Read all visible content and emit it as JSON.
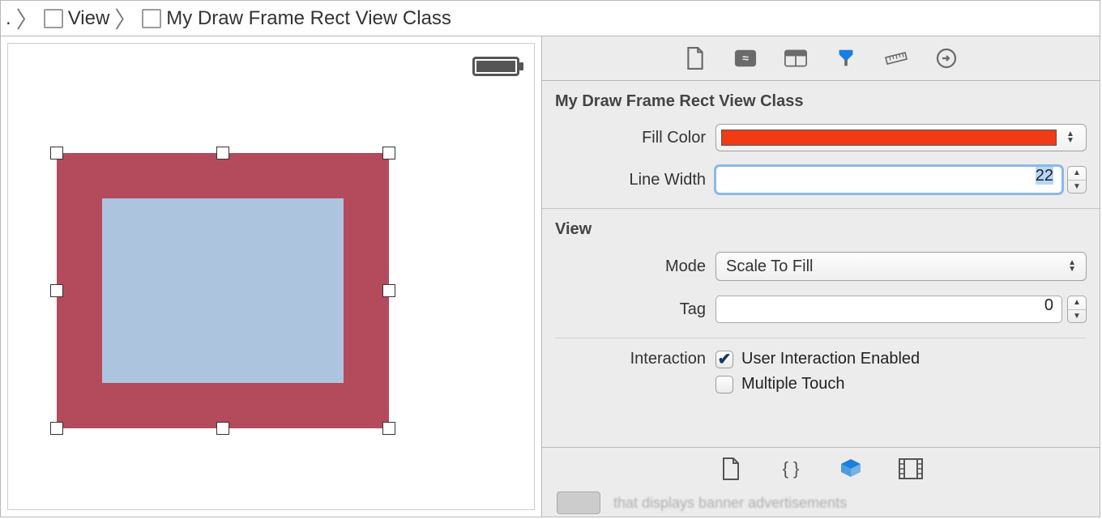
{
  "breadcrumb": {
    "prefix": ".",
    "items": [
      {
        "label": "View"
      },
      {
        "label": "My Draw Frame Rect View Class"
      }
    ]
  },
  "inspector": {
    "custom_section": {
      "title": "My Draw Frame Rect View Class",
      "fill_color_label": "Fill Color",
      "fill_color_value": "#f03c14",
      "line_width_label": "Line Width",
      "line_width_value": "22"
    },
    "view_section": {
      "title": "View",
      "mode_label": "Mode",
      "mode_value": "Scale To Fill",
      "tag_label": "Tag",
      "tag_value": "0",
      "interaction_label": "Interaction",
      "user_interaction_label": "User Interaction Enabled",
      "user_interaction_checked": true,
      "multiple_touch_label": "Multiple Touch",
      "multiple_touch_checked": false
    }
  },
  "library_clip_text": "that displays banner advertisements"
}
